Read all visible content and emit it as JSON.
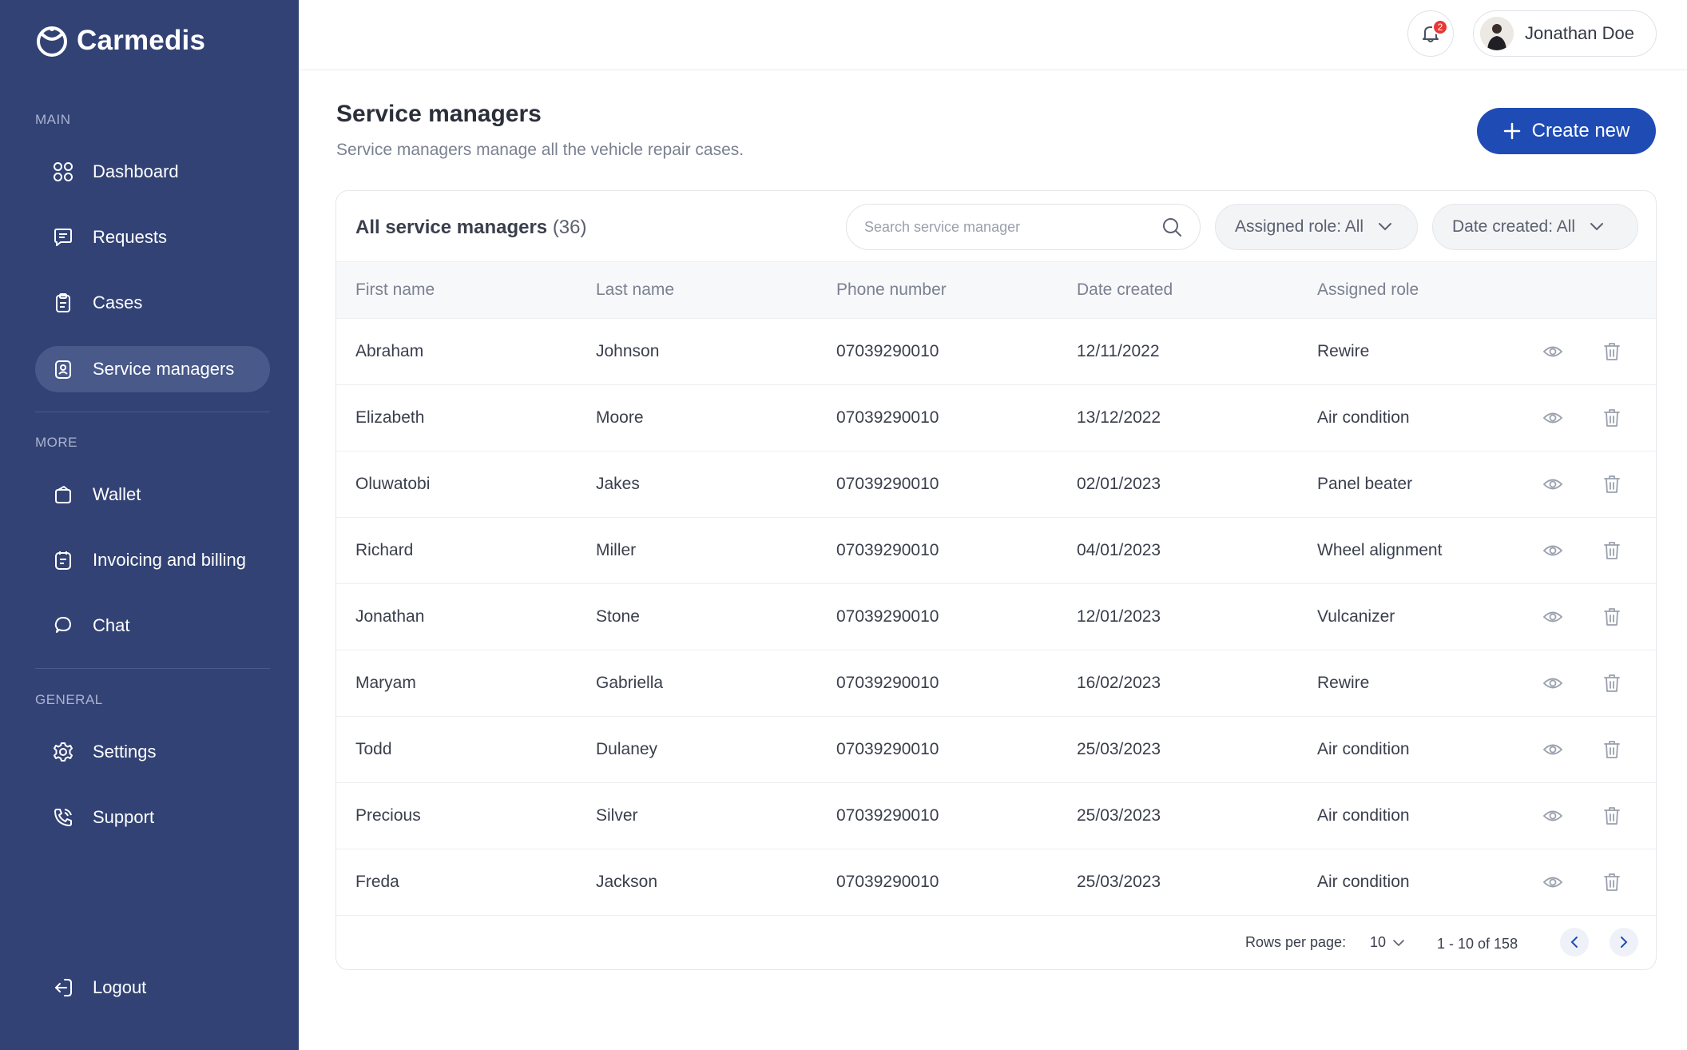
{
  "app": {
    "name": "Carmedis"
  },
  "sidebar": {
    "sections": {
      "main": "MAIN",
      "more": "MORE",
      "general": "GENERAL"
    },
    "items": [
      {
        "label": "Dashboard",
        "icon": "grid-icon"
      },
      {
        "label": "Requests",
        "icon": "message-icon"
      },
      {
        "label": "Cases",
        "icon": "clipboard-icon"
      },
      {
        "label": "Service managers",
        "icon": "user-badge-icon",
        "active": true
      },
      {
        "label": "Wallet",
        "icon": "wallet-icon"
      },
      {
        "label": "Invoicing and billing",
        "icon": "invoice-icon"
      },
      {
        "label": "Chat",
        "icon": "chat-icon"
      },
      {
        "label": "Settings",
        "icon": "gear-icon"
      },
      {
        "label": "Support",
        "icon": "phone-icon"
      }
    ],
    "logout": "Logout"
  },
  "topbar": {
    "notifications_count": "2",
    "user_name": "Jonathan Doe"
  },
  "page": {
    "title": "Service managers",
    "subtitle": "Service managers manage all the vehicle repair cases.",
    "create_label": "Create new"
  },
  "card": {
    "title": "All service managers",
    "count": "(36)",
    "search_placeholder": "Search service manager",
    "filter_role": "Assigned role: All",
    "filter_date": "Date created: All"
  },
  "table": {
    "columns": [
      "First name",
      "Last name",
      "Phone number",
      "Date created",
      "Assigned role"
    ],
    "rows": [
      [
        "Abraham",
        "Johnson",
        "07039290010",
        "12/11/2022",
        "Rewire"
      ],
      [
        "Elizabeth",
        "Moore",
        "07039290010",
        "13/12/2022",
        "Air condition"
      ],
      [
        "Oluwatobi",
        "Jakes",
        "07039290010",
        "02/01/2023",
        "Panel beater"
      ],
      [
        "Richard",
        "Miller",
        "07039290010",
        "04/01/2023",
        "Wheel alignment"
      ],
      [
        "Jonathan",
        "Stone",
        "07039290010",
        "12/01/2023",
        "Vulcanizer"
      ],
      [
        "Maryam",
        "Gabriella",
        "07039290010",
        "16/02/2023",
        "Rewire"
      ],
      [
        "Todd",
        "Dulaney",
        "07039290010",
        "25/03/2023",
        "Air condition"
      ],
      [
        "Precious",
        "Silver",
        "07039290010",
        "25/03/2023",
        "Air condition"
      ],
      [
        "Freda",
        "Jackson",
        "07039290010",
        "25/03/2023",
        "Air condition"
      ]
    ]
  },
  "pagination": {
    "rows_label": "Rows per page:",
    "rows_value": "10",
    "range": "1 - 10 of 158"
  },
  "colors": {
    "sidebar_bg": "#324275",
    "sidebar_active": "#48598a",
    "primary": "#1f4bb5",
    "badge": "#e53935"
  }
}
